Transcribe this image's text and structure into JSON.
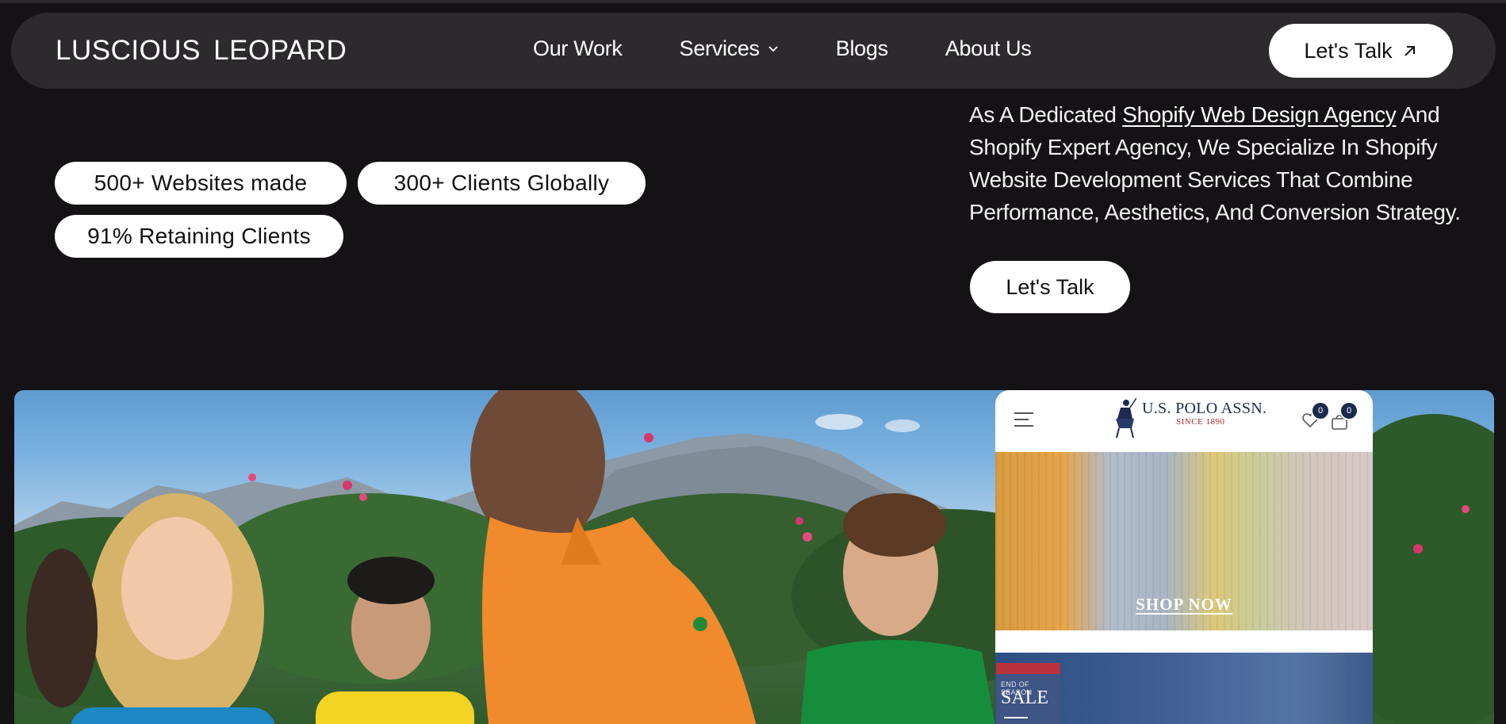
{
  "nav": {
    "logo": "LUSCIOUS  LEOPARD",
    "links": [
      "Our Work",
      "Services",
      "Blogs",
      "About Us"
    ],
    "cta": "Let's Talk"
  },
  "stats": [
    "500+ Websites made",
    "300+ Clients Globally",
    "91% Retaining Clients"
  ],
  "intro": {
    "prefix": "As A Dedicated ",
    "link": "Shopify Web Design Agency",
    "suffix": " And Shopify Expert Agency, We Specialize In Shopify Website Development Services That Combine Performance, Aesthetics, And Conversion Strategy.",
    "cta": "Let's Talk"
  },
  "mockup": {
    "brand": "U.S. POLO ASSN.",
    "since": "SINCE 1890",
    "wishlist_count": "0",
    "cart_count": "0",
    "shop_now": "SHOP NOW",
    "sale_small": "END OF SEASON",
    "sale": "SALE"
  },
  "colors": {
    "background": "#141214",
    "nav_bg": "#2c2a2d",
    "pill_bg": "#ffffff",
    "brand_navy": "#1b2a4e",
    "brand_red": "#b02534"
  }
}
